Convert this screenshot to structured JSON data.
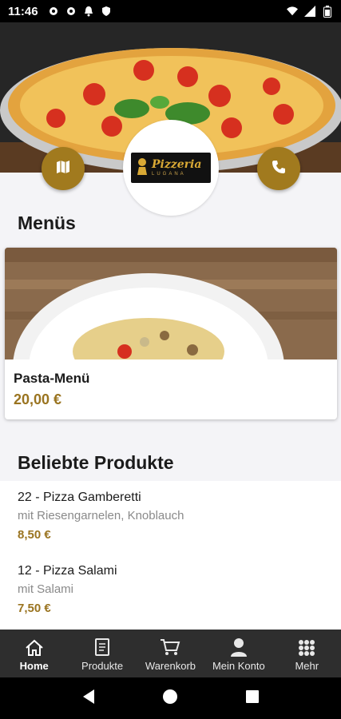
{
  "status_bar": {
    "time": "11:46"
  },
  "hero": {
    "logo_name": "Pizzeria",
    "logo_sub": "LUGANA"
  },
  "sections": {
    "menus_title": "Menüs",
    "popular_title": "Beliebte Produkte"
  },
  "menu_card": {
    "name": "Pasta-Menü",
    "price": "20,00 €"
  },
  "products": [
    {
      "name": "22 - Pizza Gamberetti",
      "desc": "mit Riesengarnelen, Knoblauch",
      "price": "8,50 €"
    },
    {
      "name": "12 - Pizza Salami",
      "desc": "mit Salami",
      "price": "7,50 €"
    }
  ],
  "tabs": [
    {
      "label": "Home",
      "icon": "home-icon",
      "active": true
    },
    {
      "label": "Produkte",
      "icon": "menu-book-icon"
    },
    {
      "label": "Warenkorb",
      "icon": "cart-icon"
    },
    {
      "label": "Mein Konto",
      "icon": "person-icon"
    },
    {
      "label": "Mehr",
      "icon": "grid-icon"
    }
  ],
  "colors": {
    "accent": "#a17a1e",
    "price": "#9a7420",
    "tabbar": "#2e2e2e"
  }
}
